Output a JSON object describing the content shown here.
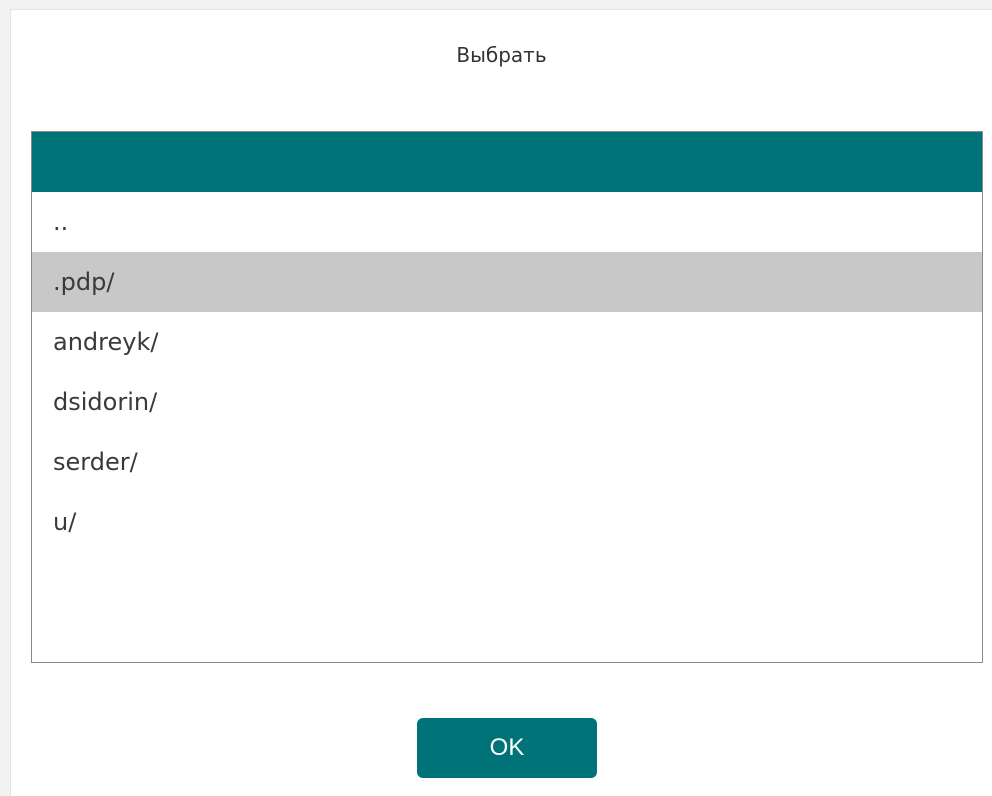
{
  "dialog": {
    "title": "Выбрать"
  },
  "file_list": {
    "header_color": "#007378",
    "selected_index": 1,
    "items": [
      {
        "label": ".."
      },
      {
        "label": ".pdp/"
      },
      {
        "label": "andreyk/"
      },
      {
        "label": "dsidorin/"
      },
      {
        "label": "serder/"
      },
      {
        "label": "u/"
      }
    ]
  },
  "buttons": {
    "ok_label": "OK"
  },
  "colors": {
    "accent": "#007378",
    "selection": "#c8c8c8"
  }
}
